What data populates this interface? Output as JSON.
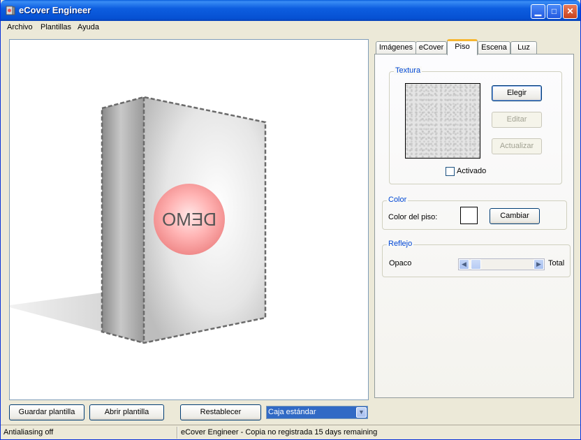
{
  "window": {
    "title": "eCover Engineer"
  },
  "menu": {
    "items": [
      "Archivo",
      "Plantillas",
      "Ayuda"
    ]
  },
  "preview": {
    "demo_label": "DEMO"
  },
  "tabs": [
    "Imágenes",
    "eCover",
    "Piso",
    "Escena",
    "Luz"
  ],
  "active_tab": "Piso",
  "textura": {
    "title": "Textura",
    "elegir": "Elegir",
    "editar": "Editar",
    "actualizar": "Actualizar",
    "activado": "Activado",
    "activado_checked": false
  },
  "color": {
    "title": "Color",
    "label": "Color del piso:",
    "swatch": "#ffffff",
    "cambiar": "Cambiar"
  },
  "reflejo": {
    "title": "Reflejo",
    "left": "Opaco",
    "right": "Total",
    "value_percent": 0
  },
  "bottom": {
    "guardar": "Guardar plantilla",
    "abrir": "Abrir plantilla",
    "restablecer": "Restablecer",
    "combo_value": "Caja estándar"
  },
  "status": {
    "left": "Antialiasing off",
    "right": "eCover Engineer - Copia no registrada 15 days remaining"
  },
  "colors": {
    "accent": "#0046d5",
    "titlebar": "#0650d2",
    "selection": "#316ac5",
    "tab_hot": "#f6b631"
  }
}
